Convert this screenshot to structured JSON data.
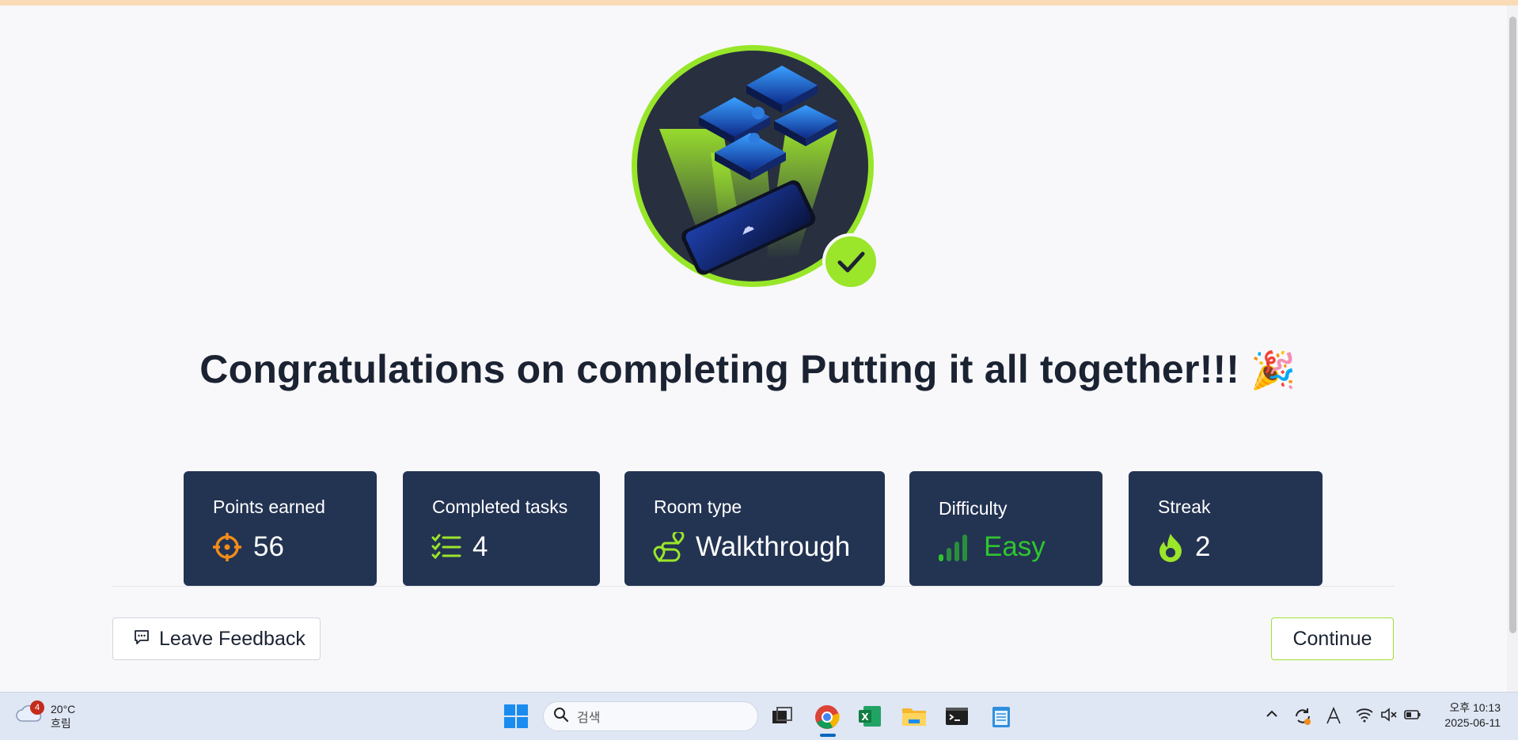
{
  "page": {
    "title_text": "Congratulations on completing Putting it all together!!!",
    "party_emoji": "🎉"
  },
  "stats": [
    {
      "label": "Points earned",
      "value": "56",
      "icon": "target-icon"
    },
    {
      "label": "Completed tasks",
      "value": "4",
      "icon": "checklist-icon"
    },
    {
      "label": "Room type",
      "value": "Walkthrough",
      "icon": "route-icon"
    },
    {
      "label": "Difficulty",
      "value": "Easy",
      "icon": "signal-bars-icon"
    },
    {
      "label": "Streak",
      "value": "2",
      "icon": "flame-icon"
    }
  ],
  "buttons": {
    "feedback": "Leave Feedback",
    "continue": "Continue"
  },
  "taskbar": {
    "weather_badge": "4",
    "temperature": "20°C",
    "condition": "흐림",
    "search_placeholder": "검색",
    "time": "오후 10:13",
    "date": "2025-06-11"
  },
  "colors": {
    "card_bg": "#233352",
    "accent_green": "#9ee035",
    "easy_green": "#2fc52f",
    "points_orange": "#f28c1a"
  }
}
